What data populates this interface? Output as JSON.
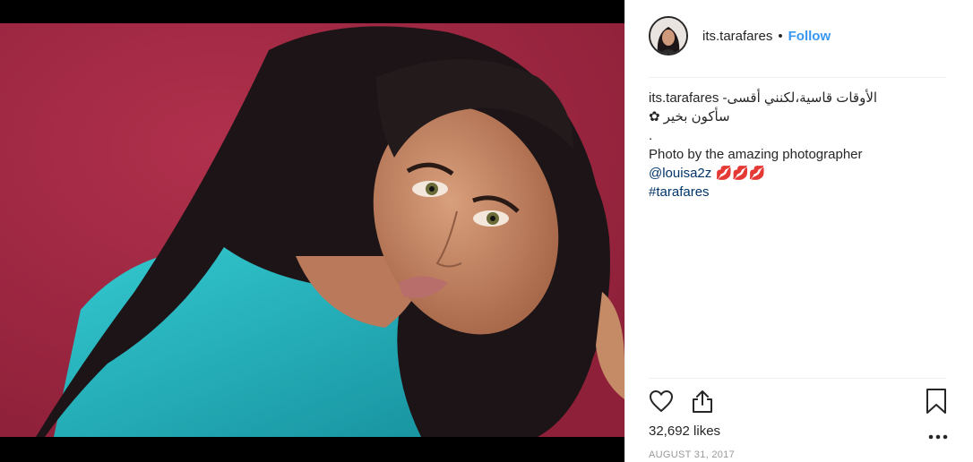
{
  "post": {
    "username": "its.tarafares",
    "separator": "•",
    "follow_label": "Follow",
    "caption": {
      "user": "its.tarafares",
      "line1_text": "الأوقات قاسية،لكنني أقسى-",
      "line2_text": "سأكون بخير",
      "line2_emoji": "✿",
      "line3": ".",
      "line4": "Photo by the amazing photographer",
      "mention": "@louisa2z",
      "mention_emoji": "💋💋💋",
      "hashtag": "#tarafares"
    },
    "likes": "32,692 likes",
    "date": "AUGUST 31, 2017"
  },
  "icons": {
    "like": "heart-icon",
    "share": "share-icon",
    "save": "bookmark-icon",
    "more": "more-options-icon"
  },
  "colors": {
    "accent": "#3897f0",
    "link": "#003569",
    "backdrop": "#a02a44",
    "shirt": "#1fb5bf"
  }
}
